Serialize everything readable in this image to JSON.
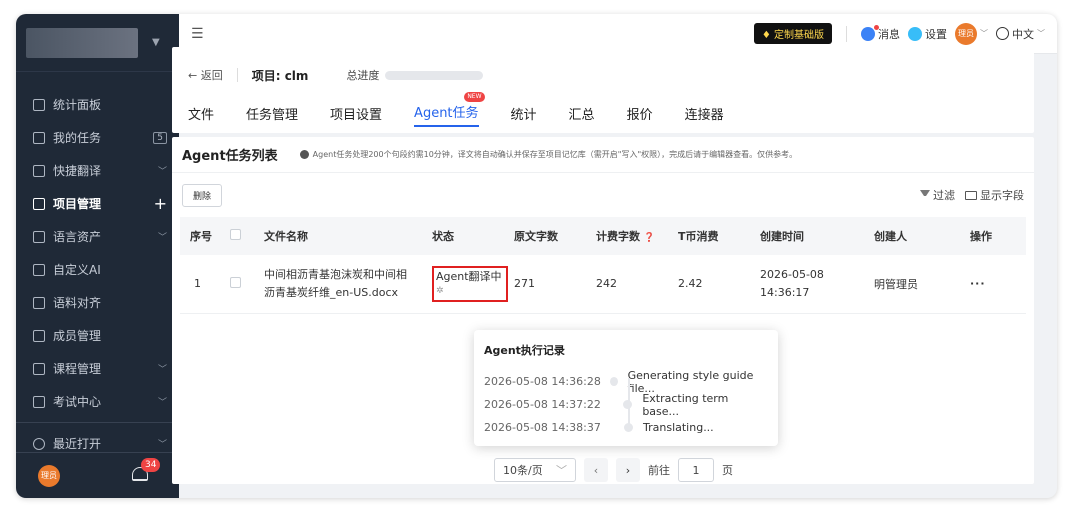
{
  "sidebar": {
    "items": [
      {
        "label": "统计面板",
        "icon": "dashboard-icon",
        "suffix": "",
        "active": false
      },
      {
        "label": "我的任务",
        "icon": "task-icon",
        "suffix": "5",
        "active": false
      },
      {
        "label": "快捷翻译",
        "icon": "translate-icon",
        "suffix": "chevron",
        "active": false
      },
      {
        "label": "项目管理",
        "icon": "project-icon",
        "suffix": "plus",
        "active": true
      },
      {
        "label": "语言资产",
        "icon": "database-icon",
        "suffix": "chevron",
        "active": false
      },
      {
        "label": "自定义AI",
        "icon": "ai-icon",
        "suffix": "",
        "active": false
      },
      {
        "label": "语料对齐",
        "icon": "align-icon",
        "suffix": "",
        "active": false
      },
      {
        "label": "成员管理",
        "icon": "members-icon",
        "suffix": "",
        "active": false
      },
      {
        "label": "课程管理",
        "icon": "course-icon",
        "suffix": "chevron",
        "active": false
      },
      {
        "label": "考试中心",
        "icon": "exam-icon",
        "suffix": "chevron",
        "active": false
      }
    ],
    "recent": {
      "label": "最近打开",
      "icon": "clock-icon"
    },
    "avatar": "理员",
    "notification_count": "34"
  },
  "topbar": {
    "plan": "定制基础版",
    "messages": "消息",
    "settings": "设置",
    "avatar": "理员",
    "language": "中文"
  },
  "project": {
    "back": "返回",
    "title": "项目: clm",
    "progress_label": "总进度",
    "progress": 0.0,
    "tabs": [
      "文件",
      "任务管理",
      "项目设置",
      "Agent任务",
      "统计",
      "汇总",
      "报价",
      "连接器"
    ],
    "active_tab": "Agent任务",
    "new_tag": "NEW"
  },
  "card": {
    "title": "Agent任务列表",
    "notice": "Agent任务处理200个句段约需10分钟，译文将自动确认并保存至项目记忆库（需开启\"写入\"权限），完成后请于编辑器查看。仅供参考。",
    "delete_label": "删除",
    "filter_label": "过滤",
    "columns_label": "显示字段"
  },
  "table": {
    "headers": [
      "序号",
      "",
      "文件名称",
      "状态",
      "原文字数",
      "计费字数",
      "T币消费",
      "创建时间",
      "创建人",
      "操作"
    ],
    "rows": [
      {
        "index": "1",
        "file_name_line1": "中间相沥青基泡沫炭和中间相",
        "file_name_line2": "沥青基炭纤维_en-US.docx",
        "status": "Agent翻译中",
        "source_words": "271",
        "billed_words": "242",
        "t_coins": "2.42",
        "created_date": "2026-05-08",
        "created_time": "14:36:17",
        "creator": "明管理员",
        "action": "···"
      }
    ]
  },
  "popover": {
    "title": "Agent执行记录",
    "logs": [
      {
        "time": "2026-05-08 14:36:28",
        "msg": "Generating style guide file..."
      },
      {
        "time": "2026-05-08 14:37:22",
        "msg": "Extracting term base..."
      },
      {
        "time": "2026-05-08 14:38:37",
        "msg": "Translating..."
      }
    ]
  },
  "pager": {
    "page_size": "10条/页",
    "goto": "前往",
    "page": "1",
    "page_unit": "页"
  }
}
